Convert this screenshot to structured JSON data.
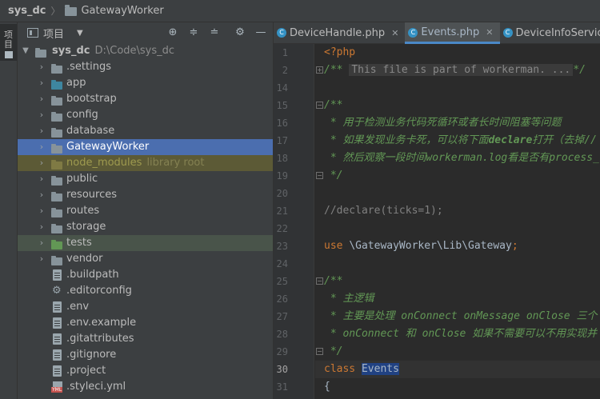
{
  "breadcrumb": {
    "root": "sys_dc",
    "folder": "GatewayWorker"
  },
  "left_strip": {
    "label": "项目"
  },
  "project_panel": {
    "title": "项目",
    "dropdown": "▼",
    "tools": [
      "⊕",
      "≑",
      "≐",
      "⚙",
      "—"
    ],
    "root": {
      "name": "sys_dc",
      "path": "D:\\Code\\sys_dc"
    },
    "items": [
      {
        "name": ".settings",
        "kind": "folder"
      },
      {
        "name": "app",
        "kind": "folder"
      },
      {
        "name": "bootstrap",
        "kind": "folder"
      },
      {
        "name": "config",
        "kind": "folder"
      },
      {
        "name": "database",
        "kind": "folder"
      },
      {
        "name": "GatewayWorker",
        "kind": "folder",
        "state": "selected"
      },
      {
        "name": "node_modules",
        "kind": "folder",
        "hint": "library root",
        "state": "ignored"
      },
      {
        "name": "public",
        "kind": "folder"
      },
      {
        "name": "resources",
        "kind": "folder"
      },
      {
        "name": "routes",
        "kind": "folder"
      },
      {
        "name": "storage",
        "kind": "folder"
      },
      {
        "name": "tests",
        "kind": "folder",
        "state": "test"
      },
      {
        "name": "vendor",
        "kind": "folder"
      },
      {
        "name": ".buildpath",
        "kind": "file"
      },
      {
        "name": ".editorconfig",
        "kind": "gear"
      },
      {
        "name": ".env",
        "kind": "file"
      },
      {
        "name": ".env.example",
        "kind": "file"
      },
      {
        "name": ".gitattributes",
        "kind": "file"
      },
      {
        "name": ".gitignore",
        "kind": "file"
      },
      {
        "name": ".project",
        "kind": "file"
      },
      {
        "name": ".styleci.yml",
        "kind": "yml"
      }
    ]
  },
  "editor": {
    "tabs": [
      {
        "label": "DeviceHandle.php",
        "active": false
      },
      {
        "label": "Events.php",
        "active": true
      },
      {
        "label": "DeviceInfoService",
        "active": false
      }
    ],
    "current_line": "30",
    "lines": [
      {
        "num": "1",
        "parts": [
          [
            "ph",
            "<?php"
          ]
        ]
      },
      {
        "num": "2",
        "parts": [
          [
            "dc",
            "/** "
          ],
          [
            "foldbox",
            "This file is part of workerman. ..."
          ],
          [
            "dc",
            "*/"
          ]
        ]
      },
      {
        "num": "14",
        "parts": []
      },
      {
        "num": "15",
        "parts": [
          [
            "dc",
            "/**"
          ]
        ]
      },
      {
        "num": "16",
        "parts": [
          [
            "dc",
            " * 用于检测业务代码死循环或者长时间阻塞等问题"
          ]
        ]
      },
      {
        "num": "17",
        "parts": [
          [
            "dc",
            " * 如果发现业务卡死，可以将下面"
          ],
          [
            "dcb",
            "declare"
          ],
          [
            "dc",
            "打开（去掉//"
          ]
        ]
      },
      {
        "num": "18",
        "parts": [
          [
            "dc",
            " * 然后观察一段时间"
          ],
          [
            "dc",
            "workerman.log"
          ],
          [
            "dc",
            "看是否有process_"
          ]
        ]
      },
      {
        "num": "19",
        "parts": [
          [
            "dc",
            " */"
          ]
        ]
      },
      {
        "num": "20",
        "parts": []
      },
      {
        "num": "21",
        "parts": [
          [
            "cm",
            "//declare(ticks=1);"
          ]
        ]
      },
      {
        "num": "22",
        "parts": []
      },
      {
        "num": "23",
        "parts": [
          [
            "kw",
            "use "
          ],
          [
            "txt",
            "\\GatewayWorker\\Lib\\Gateway"
          ],
          [
            "kw",
            ";"
          ]
        ]
      },
      {
        "num": "24",
        "parts": []
      },
      {
        "num": "25",
        "parts": [
          [
            "dc",
            "/**"
          ]
        ]
      },
      {
        "num": "26",
        "parts": [
          [
            "dc",
            " * 主逻辑"
          ]
        ]
      },
      {
        "num": "27",
        "parts": [
          [
            "dc",
            " * 主要是处理 onConnect onMessage onClose 三个"
          ]
        ]
      },
      {
        "num": "28",
        "parts": [
          [
            "dc",
            " * onConnect 和 onClose 如果不需要可以不用实现并"
          ]
        ]
      },
      {
        "num": "29",
        "parts": [
          [
            "dc",
            " */"
          ]
        ]
      },
      {
        "num": "30",
        "parts": [
          [
            "kw",
            "class "
          ],
          [
            "cls",
            "Events"
          ]
        ]
      },
      {
        "num": "31",
        "parts": [
          [
            "txt",
            "{"
          ]
        ]
      }
    ]
  },
  "colors": {
    "background": "#2b2b2b",
    "panel": "#3c3f41",
    "selection": "#4b6eaf",
    "keyword": "#cc7832",
    "doc_comment": "#629755",
    "comment": "#808080",
    "tab_underline": "#4a88c7"
  }
}
